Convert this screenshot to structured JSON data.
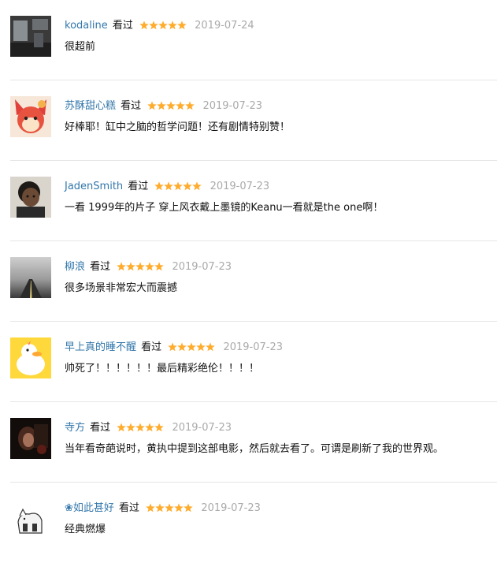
{
  "comments": [
    {
      "user": "kodaline",
      "status": "看过",
      "rating": 5,
      "date": "2019-07-24",
      "text": "很超前"
    },
    {
      "user": "苏酥甜心糕",
      "status": "看过",
      "rating": 5,
      "date": "2019-07-23",
      "text": "好棒耶！缸中之脑的哲学问题！还有剧情特别赞！"
    },
    {
      "user": "JadenSmith",
      "status": "看过",
      "rating": 5,
      "date": "2019-07-23",
      "text": "一看 1999年的片子 穿上风衣戴上墨镜的Keanu一看就是the one啊！"
    },
    {
      "user": "柳浪",
      "status": "看过",
      "rating": 5,
      "date": "2019-07-23",
      "text": "很多场景非常宏大而震撼"
    },
    {
      "user": "早上真的睡不醒",
      "status": "看过",
      "rating": 5,
      "date": "2019-07-23",
      "text": "帅死了！！！！！！最后精彩绝伦！！！！"
    },
    {
      "user": "寺方",
      "status": "看过",
      "rating": 5,
      "date": "2019-07-23",
      "text": "当年看奇葩说时，黄执中提到这部电影，然后就去看了。可谓是刷新了我的世界观。"
    },
    {
      "user": "❀如此甚好",
      "status": "看过",
      "rating": 5,
      "date": "2019-07-23",
      "text": "经典燃爆"
    }
  ],
  "colors": {
    "username": "#3377aa",
    "star": "#ffac2d",
    "date": "#aaaaaa",
    "divider": "#e6e6e6"
  },
  "icons": [
    "avatar-dark-room",
    "avatar-cartoon-fox",
    "avatar-child-photo",
    "avatar-foggy-road",
    "avatar-yellow-duck",
    "avatar-dark-portrait",
    "avatar-white-cat-sketch"
  ]
}
